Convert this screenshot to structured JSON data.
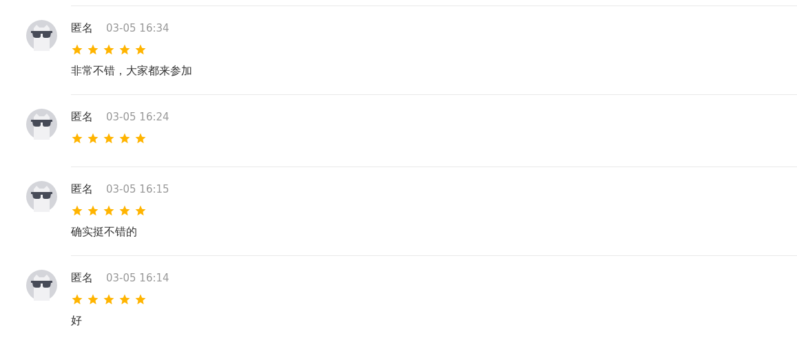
{
  "reviews": [
    {
      "name": "匿名",
      "time": "03-05 16:34",
      "stars": 5,
      "text": "非常不错，大家都来参加"
    },
    {
      "name": "匿名",
      "time": "03-05 16:24",
      "stars": 5
    },
    {
      "name": "匿名",
      "time": "03-05 16:15",
      "stars": 5,
      "text": "确实挺不错的"
    },
    {
      "name": "匿名",
      "time": "03-05 16:14",
      "stars": 5,
      "text": "好"
    }
  ]
}
